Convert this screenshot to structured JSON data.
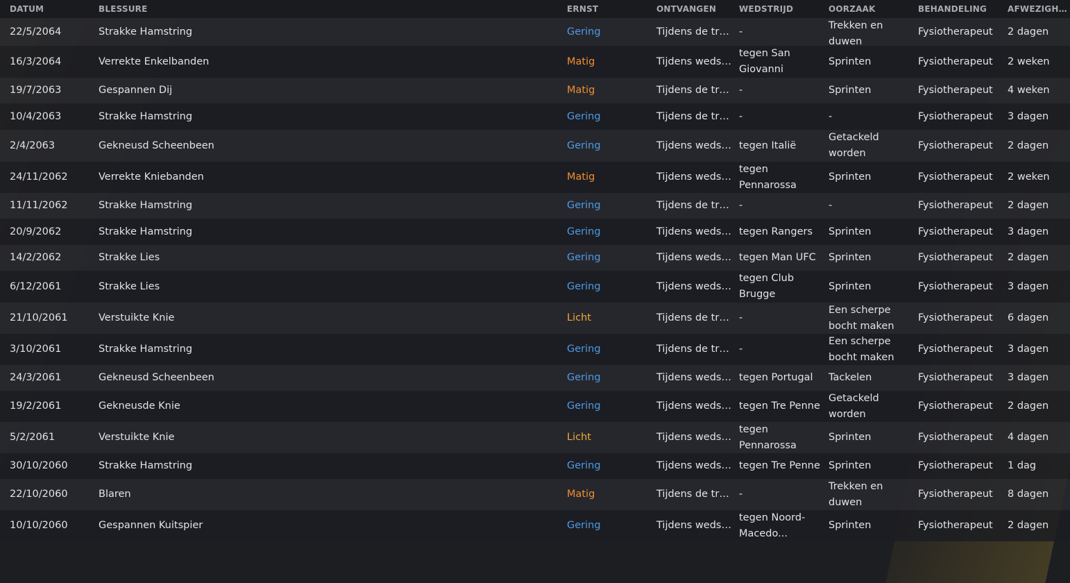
{
  "columns": {
    "datum": "DATUM",
    "blessure": "BLESSURE",
    "ernst": "ERNST",
    "ontvangen": "ONTVANGEN",
    "wedstrijd": "WEDSTRIJD",
    "oorzaak": "OORZAAK",
    "behandeling": "BEHANDELING",
    "afwezigheid": "AFWEZIGHEID"
  },
  "severity_colors": {
    "Gering": "#4d9be8",
    "Matig": "#ef8f32",
    "Licht": "#f0a83c"
  },
  "rows": [
    {
      "datum": "22/5/2064",
      "blessure": "Strakke Hamstring",
      "ernst": "Gering",
      "ontvangen": "Tijdens de train...",
      "wedstrijd": "-",
      "oorzaak": "Trekken en duwen",
      "behandeling": "Fysiotherapeut",
      "afwezigheid": "2 dagen"
    },
    {
      "datum": "16/3/2064",
      "blessure": "Verrekte Enkelbanden",
      "ernst": "Matig",
      "ontvangen": "Tijdens wedstrijd",
      "wedstrijd": "tegen San Giovanni",
      "oorzaak": "Sprinten",
      "behandeling": "Fysiotherapeut",
      "afwezigheid": "2 weken"
    },
    {
      "datum": "19/7/2063",
      "blessure": "Gespannen Dij",
      "ernst": "Matig",
      "ontvangen": "Tijdens de train...",
      "wedstrijd": "-",
      "oorzaak": "Sprinten",
      "behandeling": "Fysiotherapeut",
      "afwezigheid": "4 weken"
    },
    {
      "datum": "10/4/2063",
      "blessure": "Strakke Hamstring",
      "ernst": "Gering",
      "ontvangen": "Tijdens de train...",
      "wedstrijd": "-",
      "oorzaak": "-",
      "behandeling": "Fysiotherapeut",
      "afwezigheid": "3 dagen"
    },
    {
      "datum": "2/4/2063",
      "blessure": "Gekneusd Scheenbeen",
      "ernst": "Gering",
      "ontvangen": "Tijdens wedstrijd",
      "wedstrijd": "tegen Italië",
      "oorzaak": "Getackeld worden",
      "behandeling": "Fysiotherapeut",
      "afwezigheid": "2 dagen"
    },
    {
      "datum": "24/11/2062",
      "blessure": "Verrekte Kniebanden",
      "ernst": "Matig",
      "ontvangen": "Tijdens wedstrijd",
      "wedstrijd": "tegen Pennarossa",
      "oorzaak": "Sprinten",
      "behandeling": "Fysiotherapeut",
      "afwezigheid": "2 weken"
    },
    {
      "datum": "11/11/2062",
      "blessure": "Strakke Hamstring",
      "ernst": "Gering",
      "ontvangen": "Tijdens de train...",
      "wedstrijd": "-",
      "oorzaak": "-",
      "behandeling": "Fysiotherapeut",
      "afwezigheid": "2 dagen"
    },
    {
      "datum": "20/9/2062",
      "blessure": "Strakke Hamstring",
      "ernst": "Gering",
      "ontvangen": "Tijdens wedstrijd",
      "wedstrijd": "tegen Rangers",
      "oorzaak": "Sprinten",
      "behandeling": "Fysiotherapeut",
      "afwezigheid": "3 dagen"
    },
    {
      "datum": "14/2/2062",
      "blessure": "Strakke Lies",
      "ernst": "Gering",
      "ontvangen": "Tijdens wedstrijd",
      "wedstrijd": "tegen Man UFC",
      "oorzaak": "Sprinten",
      "behandeling": "Fysiotherapeut",
      "afwezigheid": "2 dagen"
    },
    {
      "datum": "6/12/2061",
      "blessure": "Strakke Lies",
      "ernst": "Gering",
      "ontvangen": "Tijdens wedstrijd",
      "wedstrijd": "tegen Club Brugge",
      "oorzaak": "Sprinten",
      "behandeling": "Fysiotherapeut",
      "afwezigheid": "3 dagen"
    },
    {
      "datum": "21/10/2061",
      "blessure": "Verstuikte Knie",
      "ernst": "Licht",
      "ontvangen": "Tijdens de train...",
      "wedstrijd": "-",
      "oorzaak": "Een scherpe bocht maken",
      "behandeling": "Fysiotherapeut",
      "afwezigheid": "6 dagen"
    },
    {
      "datum": "3/10/2061",
      "blessure": "Strakke Hamstring",
      "ernst": "Gering",
      "ontvangen": "Tijdens de train...",
      "wedstrijd": "-",
      "oorzaak": "Een scherpe bocht maken",
      "behandeling": "Fysiotherapeut",
      "afwezigheid": "3 dagen"
    },
    {
      "datum": "24/3/2061",
      "blessure": "Gekneusd Scheenbeen",
      "ernst": "Gering",
      "ontvangen": "Tijdens wedstrijd",
      "wedstrijd": "tegen Portugal",
      "oorzaak": "Tackelen",
      "behandeling": "Fysiotherapeut",
      "afwezigheid": "3 dagen"
    },
    {
      "datum": "19/2/2061",
      "blessure": "Gekneusde Knie",
      "ernst": "Gering",
      "ontvangen": "Tijdens wedstrijd",
      "wedstrijd": "tegen Tre Penne",
      "oorzaak": "Getackeld worden",
      "behandeling": "Fysiotherapeut",
      "afwezigheid": "2 dagen"
    },
    {
      "datum": "5/2/2061",
      "blessure": "Verstuikte Knie",
      "ernst": "Licht",
      "ontvangen": "Tijdens wedstrijd",
      "wedstrijd": "tegen Pennarossa",
      "oorzaak": "Sprinten",
      "behandeling": "Fysiotherapeut",
      "afwezigheid": "4 dagen"
    },
    {
      "datum": "30/10/2060",
      "blessure": "Strakke Hamstring",
      "ernst": "Gering",
      "ontvangen": "Tijdens wedstrijd",
      "wedstrijd": "tegen Tre Penne",
      "oorzaak": "Sprinten",
      "behandeling": "Fysiotherapeut",
      "afwezigheid": "1 dag"
    },
    {
      "datum": "22/10/2060",
      "blessure": "Blaren",
      "ernst": "Matig",
      "ontvangen": "Tijdens de train...",
      "wedstrijd": "-",
      "oorzaak": "Trekken en duwen",
      "behandeling": "Fysiotherapeut",
      "afwezigheid": "8 dagen"
    },
    {
      "datum": "10/10/2060",
      "blessure": "Gespannen Kuitspier",
      "ernst": "Gering",
      "ontvangen": "Tijdens wedstrijd",
      "wedstrijd": "tegen Noord-Macedo...",
      "oorzaak": "Sprinten",
      "behandeling": "Fysiotherapeut",
      "afwezigheid": "2 dagen"
    }
  ]
}
